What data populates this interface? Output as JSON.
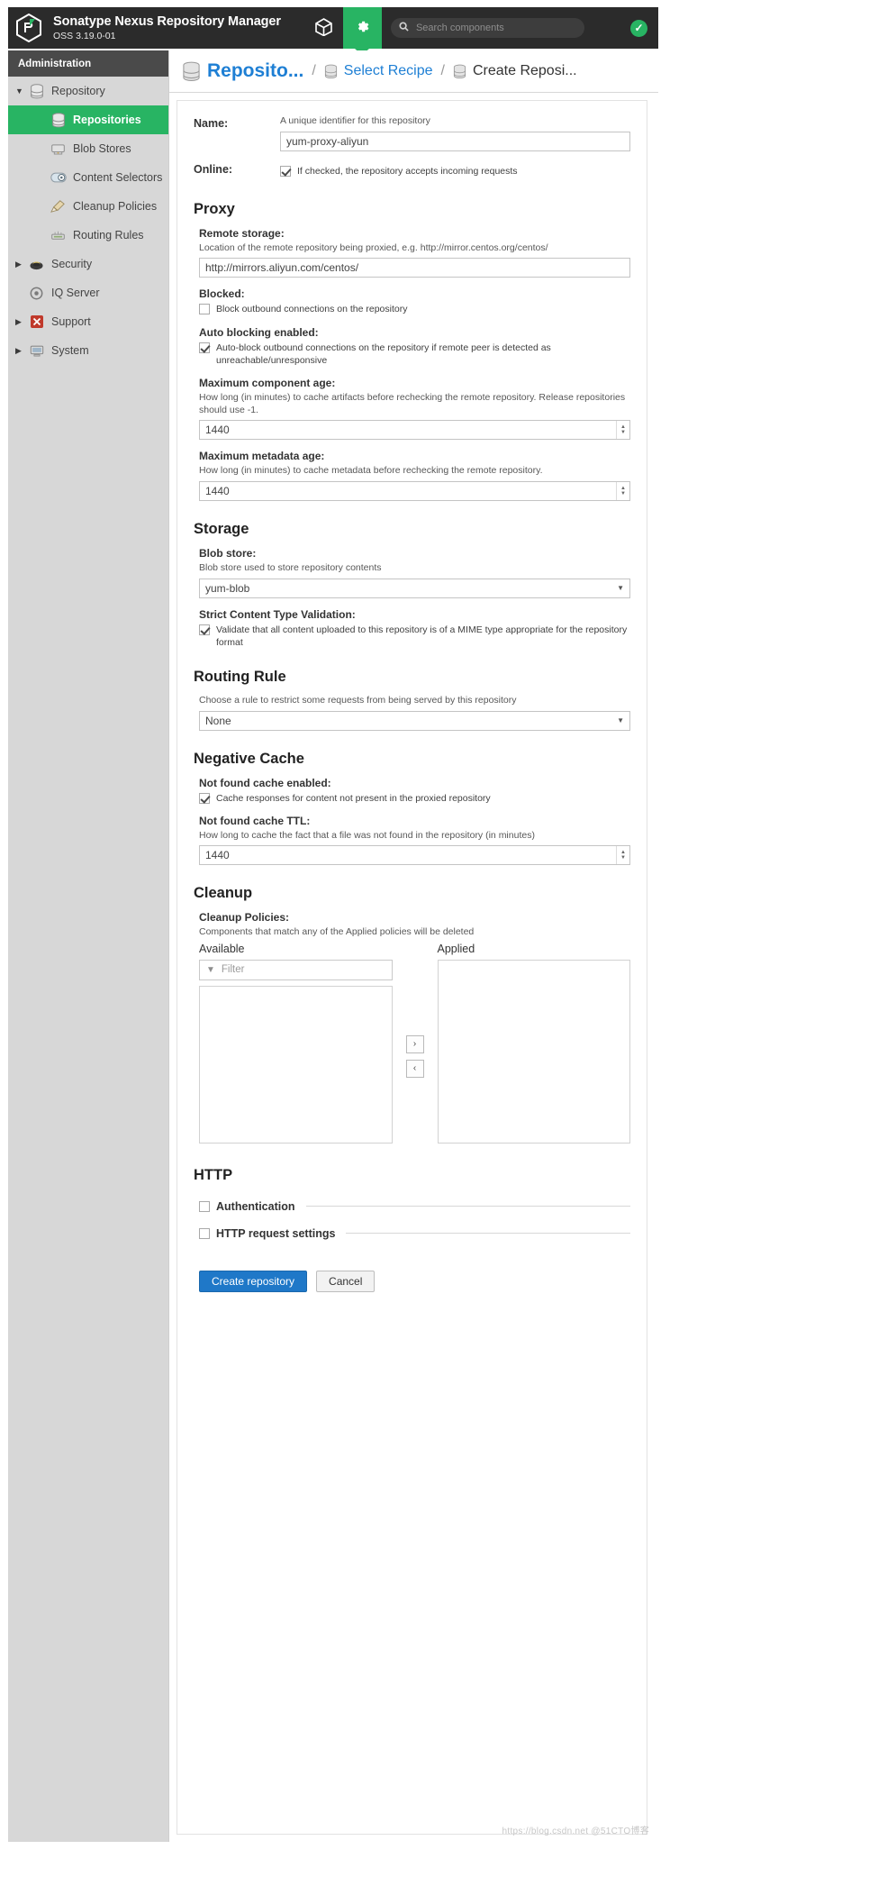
{
  "header": {
    "brand_title": "Sonatype Nexus Repository Manager",
    "brand_version": "OSS 3.19.0-01",
    "browse_icon": "cube-icon",
    "admin_icon": "gear-icon",
    "search_icon": "search-icon",
    "search_placeholder": "Search components",
    "status_icon": "check-circle-icon"
  },
  "sidebar": {
    "section_title": "Administration",
    "items": [
      {
        "label": "Repository",
        "icon": "database-icon",
        "level": 0,
        "expanded": true,
        "selected": false
      },
      {
        "label": "Repositories",
        "icon": "database-icon",
        "level": 1,
        "expanded": null,
        "selected": true
      },
      {
        "label": "Blob Stores",
        "icon": "drive-icon",
        "level": 1,
        "expanded": null,
        "selected": false
      },
      {
        "label": "Content Selectors",
        "icon": "toggle-icon",
        "level": 1,
        "expanded": null,
        "selected": false
      },
      {
        "label": "Cleanup Policies",
        "icon": "brush-icon",
        "level": 1,
        "expanded": null,
        "selected": false
      },
      {
        "label": "Routing Rules",
        "icon": "router-icon",
        "level": 1,
        "expanded": null,
        "selected": false
      },
      {
        "label": "Security",
        "icon": "shield-icon",
        "level": 0,
        "expanded": false,
        "selected": false
      },
      {
        "label": "IQ Server",
        "icon": "iq-icon",
        "level": 0,
        "expanded": null,
        "selected": false
      },
      {
        "label": "Support",
        "icon": "support-icon",
        "level": 0,
        "expanded": false,
        "selected": false
      },
      {
        "label": "System",
        "icon": "system-icon",
        "level": 0,
        "expanded": false,
        "selected": false
      }
    ]
  },
  "breadcrumb": {
    "items": [
      {
        "label": "Reposito...",
        "icon": "database-icon",
        "style": "title-link"
      },
      {
        "label": "Select Recipe",
        "icon": "database-icon",
        "style": "link"
      },
      {
        "label": "Create Reposi...",
        "icon": "database-icon",
        "style": "plain"
      }
    ],
    "separator": "/"
  },
  "form": {
    "name": {
      "label": "Name:",
      "hint": "A unique identifier for this repository",
      "value": "yum-proxy-aliyun"
    },
    "online": {
      "label": "Online:",
      "checkbox_text": "If checked, the repository accepts incoming requests",
      "checked": true
    },
    "proxy": {
      "title": "Proxy",
      "remote_storage": {
        "label": "Remote storage:",
        "hint": "Location of the remote repository being proxied, e.g. http://mirror.centos.org/centos/",
        "value": "http://mirrors.aliyun.com/centos/"
      },
      "blocked": {
        "label": "Blocked:",
        "checkbox_text": "Block outbound connections on the repository",
        "checked": false
      },
      "auto_blocking": {
        "label": "Auto blocking enabled:",
        "checkbox_text": "Auto-block outbound connections on the repository if remote peer is detected as unreachable/unresponsive",
        "checked": true
      },
      "max_component_age": {
        "label": "Maximum component age:",
        "hint": "How long (in minutes) to cache artifacts before rechecking the remote repository. Release repositories should use -1.",
        "value": "1440"
      },
      "max_metadata_age": {
        "label": "Maximum metadata age:",
        "hint": "How long (in minutes) to cache metadata before rechecking the remote repository.",
        "value": "1440"
      }
    },
    "storage": {
      "title": "Storage",
      "blob_store": {
        "label": "Blob store:",
        "hint": "Blob store used to store repository contents",
        "value": "yum-blob"
      },
      "strict_validation": {
        "label": "Strict Content Type Validation:",
        "checkbox_text": "Validate that all content uploaded to this repository is of a MIME type appropriate for the repository format",
        "checked": true
      }
    },
    "routing_rule": {
      "title": "Routing Rule",
      "hint": "Choose a rule to restrict some requests from being served by this repository",
      "value": "None"
    },
    "negative_cache": {
      "title": "Negative Cache",
      "not_found_enabled": {
        "label": "Not found cache enabled:",
        "checkbox_text": "Cache responses for content not present in the proxied repository",
        "checked": true
      },
      "ttl": {
        "label": "Not found cache TTL:",
        "hint": "How long to cache the fact that a file was not found in the repository (in minutes)",
        "value": "1440"
      }
    },
    "cleanup": {
      "title": "Cleanup",
      "label": "Cleanup Policies:",
      "hint": "Components that match any of the Applied policies will be deleted",
      "available_header": "Available",
      "applied_header": "Applied",
      "filter_placeholder": "Filter",
      "move_right": "›",
      "move_left": "‹",
      "available_items": [],
      "applied_items": []
    },
    "http": {
      "title": "HTTP",
      "authentication": {
        "label": "Authentication",
        "checked": false
      },
      "request_settings": {
        "label": "HTTP request settings",
        "checked": false
      }
    },
    "buttons": {
      "create": "Create repository",
      "cancel": "Cancel"
    }
  },
  "watermark": "https://blog.csdn.net @51CTO博客",
  "colors": {
    "accent_green": "#28b463",
    "link_blue": "#1e7fd4",
    "primary_button": "#1f78c8",
    "header_bg": "#2b2b2b",
    "sidebar_bg": "#d7d7d7"
  }
}
